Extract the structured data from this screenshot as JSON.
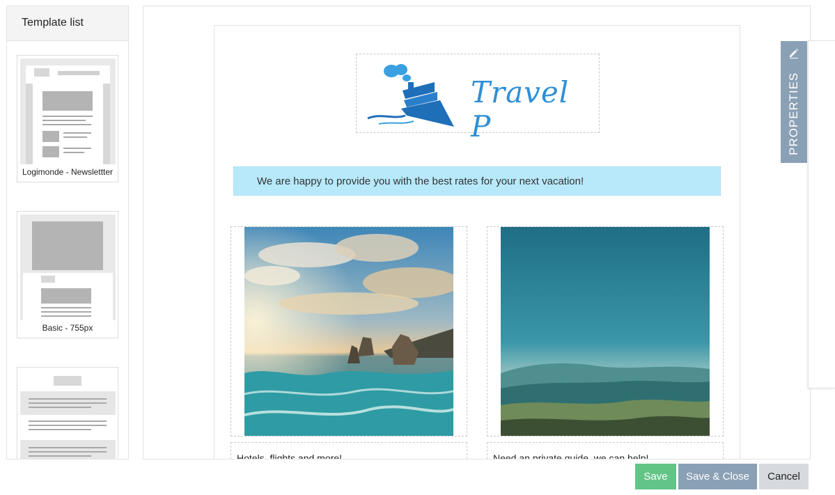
{
  "template_list": {
    "title": "Template list",
    "templates": [
      {
        "label": "Logimonde - Newslettter"
      },
      {
        "label": "Basic - 755px"
      },
      {
        "label": ""
      }
    ]
  },
  "email": {
    "logo_text": "Travel P",
    "banner_text": "We are happy to provide you with the best rates for your next vacation!",
    "columns": [
      {
        "caption": "Hotels, flights and more!"
      },
      {
        "caption": "Need an private guide, we can help!"
      }
    ]
  },
  "properties_tab": {
    "label": "PROPERTIES",
    "icon": "pencil-icon"
  },
  "buttons": {
    "save": "Save",
    "save_close": "Save & Close",
    "cancel": "Cancel"
  },
  "colors": {
    "save": "#62c487",
    "save_close": "#8aa0b5",
    "cancel": "#d6dadf",
    "banner": "#b7e9fb",
    "logo": "#2e8fd6"
  }
}
